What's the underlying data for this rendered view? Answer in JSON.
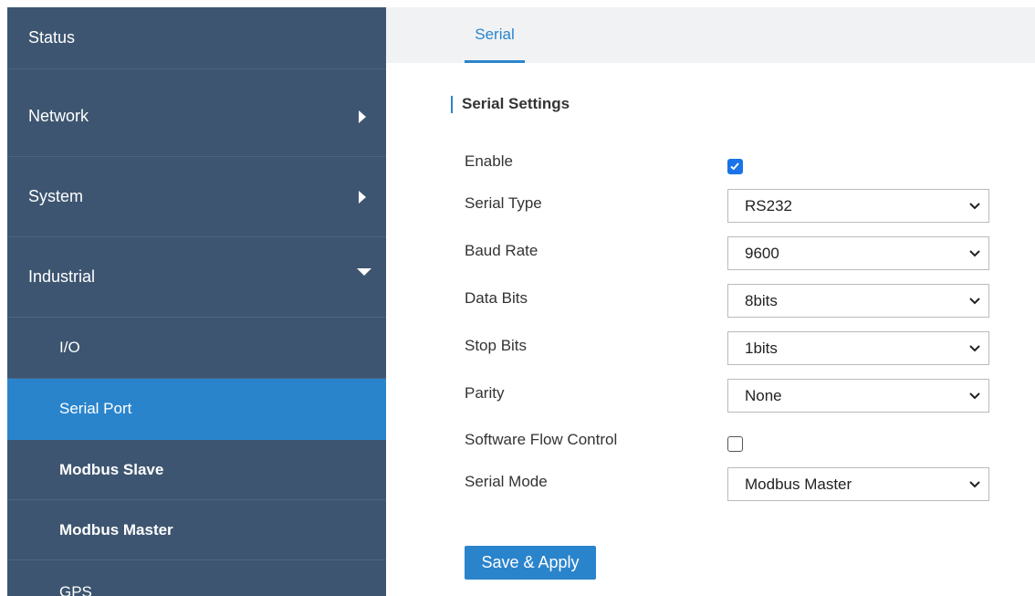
{
  "sidebar": {
    "items": [
      {
        "label": "Status"
      },
      {
        "label": "Network"
      },
      {
        "label": "System"
      },
      {
        "label": "Industrial"
      },
      {
        "label": "I/O"
      },
      {
        "label": "Serial Port"
      },
      {
        "label": "Modbus Slave"
      },
      {
        "label": "Modbus Master"
      },
      {
        "label": "GPS"
      }
    ]
  },
  "tabs": [
    {
      "label": "Serial"
    }
  ],
  "section": {
    "title": "Serial Settings"
  },
  "form": {
    "enable": {
      "label": "Enable",
      "checked": true
    },
    "serial_type": {
      "label": "Serial Type",
      "value": "RS232"
    },
    "baud_rate": {
      "label": "Baud Rate",
      "value": "9600"
    },
    "data_bits": {
      "label": "Data Bits",
      "value": "8bits"
    },
    "stop_bits": {
      "label": "Stop Bits",
      "value": "1bits"
    },
    "parity": {
      "label": "Parity",
      "value": "None"
    },
    "software_flow_control": {
      "label": "Software Flow Control",
      "checked": false
    },
    "serial_mode": {
      "label": "Serial Mode",
      "value": "Modbus Master"
    }
  },
  "actions": {
    "save_apply": "Save & Apply"
  },
  "colors": {
    "sidebar": "#3d5570",
    "accent": "#2a84cc",
    "checkbox": "#1a73e8"
  }
}
